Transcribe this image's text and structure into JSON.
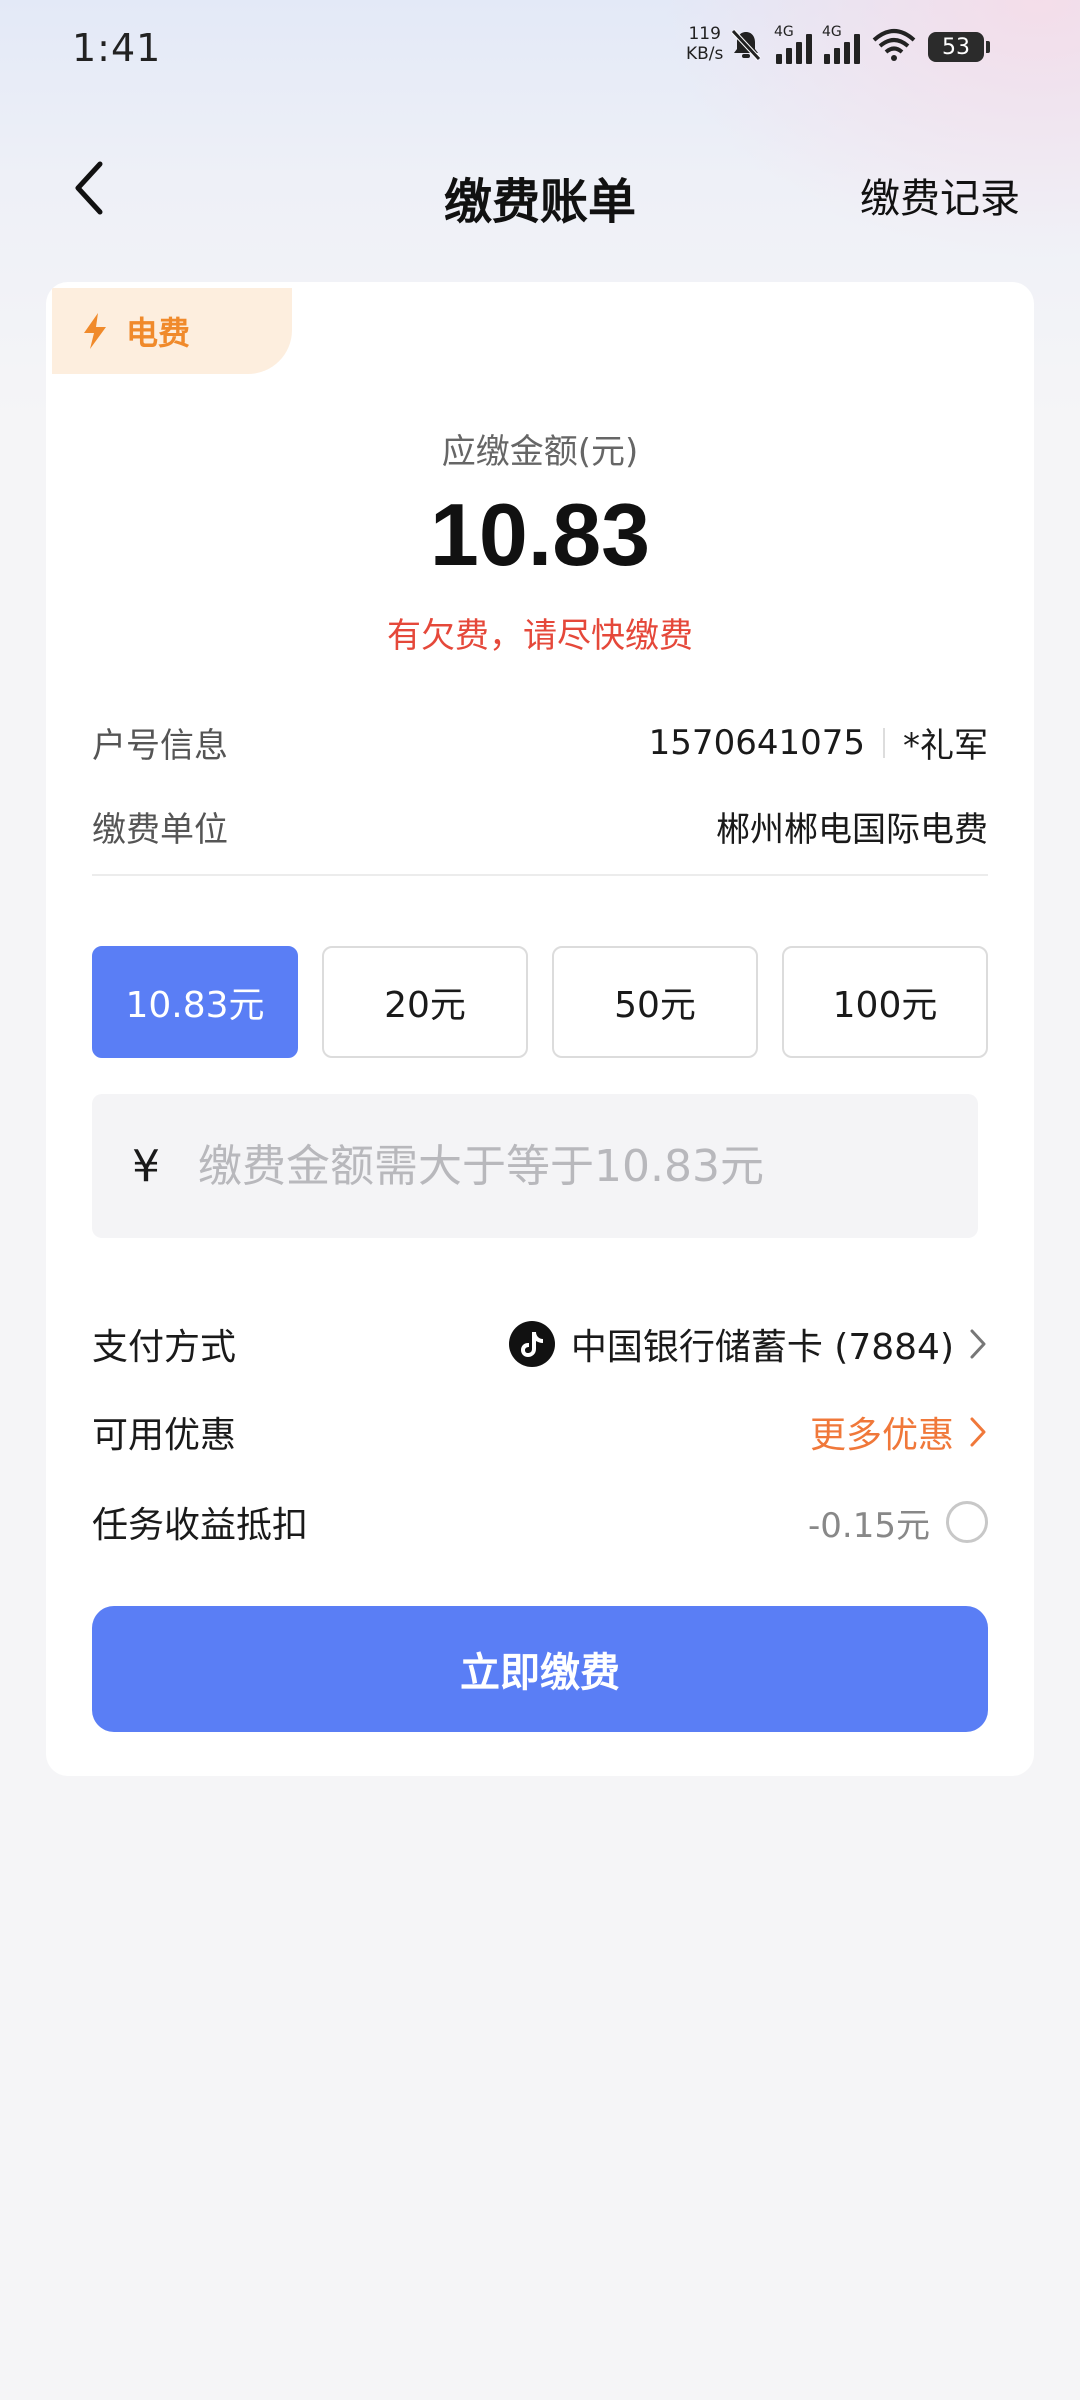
{
  "status_bar": {
    "time": "1:41",
    "net_speed_value": "119",
    "net_speed_unit": "KB/s",
    "signal1_label": "4G",
    "signal2_label": "4G",
    "battery": "53"
  },
  "header": {
    "title": "缴费账单",
    "records_label": "缴费记录"
  },
  "bill": {
    "tag_label": "电费",
    "amount_label": "应缴金额(元)",
    "amount": "10.83",
    "warning": "有欠费，请尽快缴费",
    "account_label": "户号信息",
    "account_number": "1570641075",
    "account_name": "*礼军",
    "unit_label": "缴费单位",
    "unit_value": "郴州郴电国际电费"
  },
  "amount_options": [
    {
      "label": "10.83元",
      "selected": true
    },
    {
      "label": "20元",
      "selected": false
    },
    {
      "label": "50元",
      "selected": false
    },
    {
      "label": "100元",
      "selected": false
    }
  ],
  "custom_amount": {
    "currency_symbol": "¥",
    "value": "",
    "placeholder": "缴费金额需大于等于10.83元"
  },
  "payment": {
    "method_label": "支付方式",
    "method_value": "中国银行储蓄卡 (7884)",
    "promo_label": "可用优惠",
    "promo_value": "更多优惠",
    "task_label": "任务收益抵扣",
    "task_value": "-0.15元"
  },
  "submit_label": "立即缴费",
  "colors": {
    "accent": "#5a7ef5",
    "warning": "#e5483a",
    "promo": "#f0783a",
    "tag": "#f08a2b",
    "tag_bg": "#fdeede"
  }
}
